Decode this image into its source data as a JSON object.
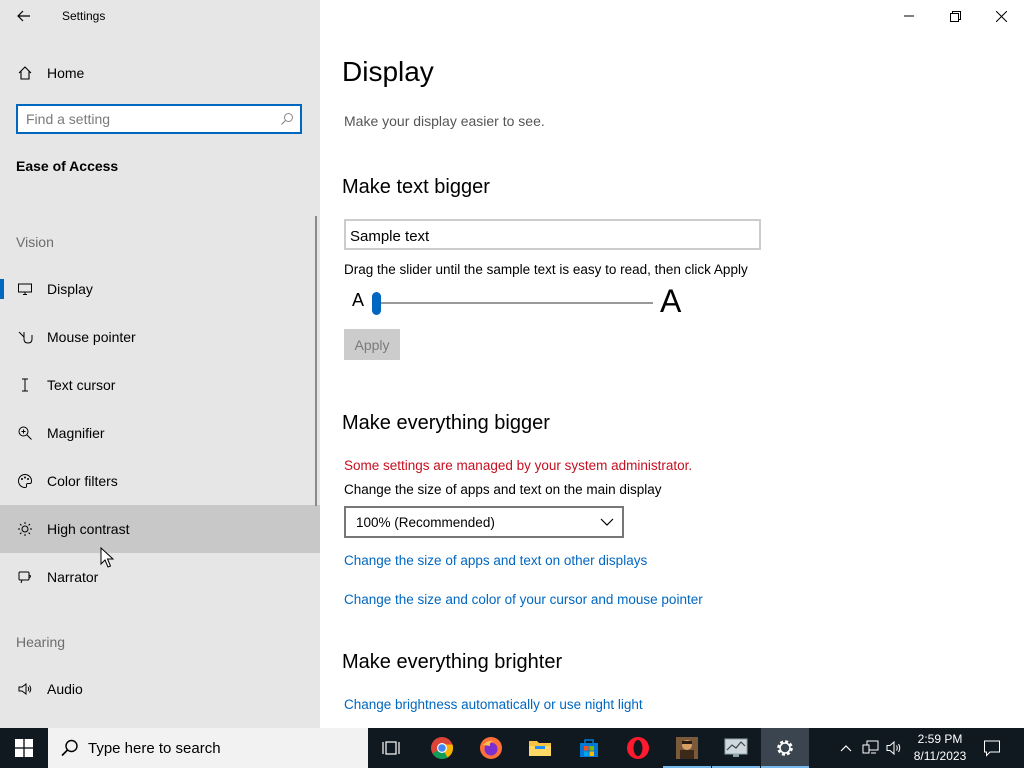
{
  "window": {
    "title": "Settings"
  },
  "sidebar": {
    "home_label": "Home",
    "search_placeholder": "Find a setting",
    "section_title": "Ease of Access",
    "group_vision": "Vision",
    "group_hearing": "Hearing",
    "items": [
      {
        "label": "Display",
        "icon": "display-icon"
      },
      {
        "label": "Mouse pointer",
        "icon": "mouse-pointer-icon"
      },
      {
        "label": "Text cursor",
        "icon": "text-cursor-icon"
      },
      {
        "label": "Magnifier",
        "icon": "magnifier-icon"
      },
      {
        "label": "Color filters",
        "icon": "palette-icon"
      },
      {
        "label": "High contrast",
        "icon": "sun-icon"
      },
      {
        "label": "Narrator",
        "icon": "narrator-icon"
      },
      {
        "label": "Audio",
        "icon": "speaker-icon"
      }
    ],
    "selected": "Display",
    "hovered": "High contrast"
  },
  "main": {
    "title": "Display",
    "subtitle": "Make your display easier to see.",
    "text_bigger": {
      "heading": "Make text bigger",
      "sample": "Sample text",
      "instruction": "Drag the slider until the sample text is easy to read, then click Apply",
      "small_a": "A",
      "big_a": "A",
      "slider_value_fraction": 0.0,
      "apply_label": "Apply"
    },
    "everything_bigger": {
      "heading": "Make everything bigger",
      "warning": "Some settings are managed by your system administrator.",
      "scale_label": "Change the size of apps and text on the main display",
      "scale_value": "100% (Recommended)",
      "link_other_displays": "Change the size of apps and text on other displays",
      "link_cursor": "Change the size and color of your cursor and mouse pointer"
    },
    "everything_brighter": {
      "heading": "Make everything brighter",
      "link_brightness": "Change brightness automatically or use night light"
    }
  },
  "taskbar": {
    "search_placeholder": "Type here to search",
    "apps": [
      "task-view",
      "chrome",
      "firefox",
      "file-explorer",
      "microsoft-store",
      "opera",
      "app-game",
      "app-monitor",
      "settings"
    ],
    "time": "2:59 PM",
    "date": "8/11/2023"
  },
  "colors": {
    "accent": "#0067c0",
    "warning": "#c50f1f",
    "sidebar_bg": "#e6e6e6",
    "taskbar_bg": "#101820"
  }
}
